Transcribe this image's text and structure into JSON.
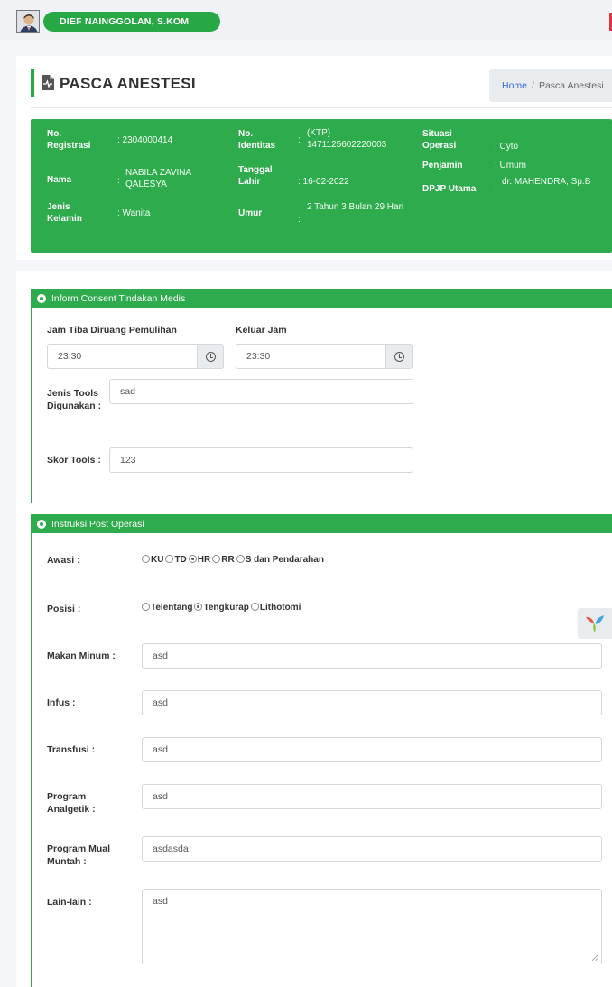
{
  "user": {
    "name": "DIEF NAINGGOLAN, S.KOM"
  },
  "page": {
    "title": "PASCA ANESTESI",
    "breadcrumb": {
      "home": "Home",
      "separator": "/",
      "current": "Pasca Anestesi"
    }
  },
  "patient": {
    "no_registrasi_label": "No. Registrasi",
    "no_registrasi": ": 2304000414",
    "nama_label": "Nama",
    "nama": "NABILA ZAVINA QALESYA",
    "jenis_kelamin_label": "Jenis Kelamin",
    "jenis_kelamin": ": Wanita",
    "no_identitas_label": "No. Identitas",
    "no_identitas": "(KTP) 1471125602220003",
    "tanggal_lahir_label": "Tanggal Lahir",
    "tanggal_lahir": ": 16-02-2022",
    "umur_label": "Umur",
    "umur": "2 Tahun 3 Bulan 29 Hari",
    "situasi_operasi_label": "Situasi Operasi",
    "situasi_operasi": ": Cyto",
    "penjamin_label": "Penjamin",
    "penjamin": ": Umum",
    "dpjp_utama_label": "DPJP Utama",
    "dpjp_utama": "dr. MAHENDRA, Sp.B"
  },
  "inform_consent": {
    "header": "Inform Consent Tindakan Medis",
    "jam_tiba_label": "Jam Tiba Diruang Pemulihan",
    "jam_tiba": "23:30",
    "keluar_jam_label": "Keluar Jam",
    "keluar_jam": "23:30",
    "jenis_tools_label": "Jenis Tools Digunakan :",
    "jenis_tools": "sad",
    "skor_tools_label": "Skor Tools :",
    "skor_tools": "123"
  },
  "instruksi": {
    "header": "Instruksi Post Operasi",
    "awasi_label": "Awasi :",
    "awasi_options": [
      "KU",
      "TD",
      "HR",
      "RR",
      "S dan Pendarahan"
    ],
    "awasi_selected": "HR",
    "posisi_label": "Posisi :",
    "posisi_options": [
      "Telentang",
      "Tengkurap",
      "Lithotomi"
    ],
    "posisi_selected": "Tengkurap",
    "makan_minum_label": "Makan Minum :",
    "makan_minum": "asd",
    "infus_label": "Infus :",
    "infus": "asd",
    "transfusi_label": "Transfusi :",
    "transfusi": "asd",
    "program_analgetik_label": "Program Analgetik :",
    "program_analgetik": "asd",
    "program_mual_label": "Program Mual Muntah :",
    "program_mual": "asdasda",
    "lain_lain_label": "Lain-lain :",
    "lain_lain": "asd"
  },
  "colors": {
    "primary_green": "#2eab4c",
    "link_blue": "#2f6bd7",
    "alert_red": "#dc3545"
  },
  "icons": [
    "avatar",
    "document-icon",
    "clock-icon",
    "radio-icon",
    "yii-logo-icon"
  ]
}
